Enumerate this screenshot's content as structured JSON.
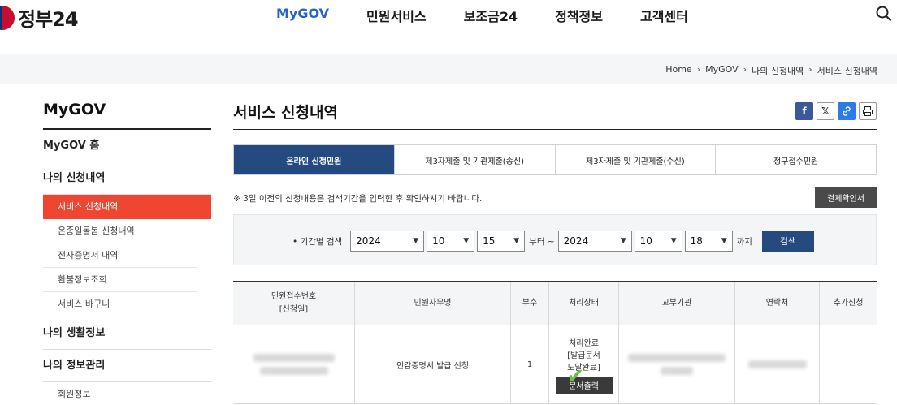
{
  "header": {
    "logo_text": "정부24",
    "nav": [
      "MyGOV",
      "민원서비스",
      "보조금24",
      "정책정보",
      "고객센터"
    ],
    "active_nav": "MyGOV"
  },
  "breadcrumb": [
    "Home",
    "MyGOV",
    "나의 신청내역",
    "서비스 신청내역"
  ],
  "sidebar": {
    "title": "MyGOV",
    "home": "MyGOV 홈",
    "section1": "나의 신청내역",
    "section1_items": [
      "서비스 신청내역",
      "온종일돌봄 신청내역",
      "전자증명서 내역",
      "환불정보조회",
      "서비스 바구니"
    ],
    "section2": "나의 생활정보",
    "section3": "나의 정보관리",
    "section3_items": [
      "회원정보"
    ]
  },
  "content": {
    "title": "서비스 신청내역",
    "tabs": [
      "온라인 신청민원",
      "제3자제출 및 기관제출(송신)",
      "제3자제출 및 기관제출(수신)",
      "청구접수민원"
    ],
    "notice": "※ 3일 이전의 신청내용은 검색기간을 입력한 후 확인하시기 바랍니다.",
    "receipt_button": "결제확인서",
    "search": {
      "label": "• 기간별 검색",
      "from_year": "2024",
      "from_month": "10",
      "from_day": "15",
      "from_suffix": "부터 ~",
      "to_year": "2024",
      "to_month": "10",
      "to_day": "18",
      "to_suffix": "까지",
      "button": "검색"
    }
  },
  "table": {
    "headers": [
      "민원접수번호\n[신청일]",
      "민원사무명",
      "부수",
      "처리상태",
      "교부기관",
      "연락처",
      "추가신청"
    ],
    "row": {
      "service_name": "인감증명서 발급 신청",
      "copies": "1",
      "status_line1": "처리완료",
      "status_line2": "[발급문서",
      "status_line3": "도달완료]",
      "doc_button": "문서출력"
    }
  }
}
